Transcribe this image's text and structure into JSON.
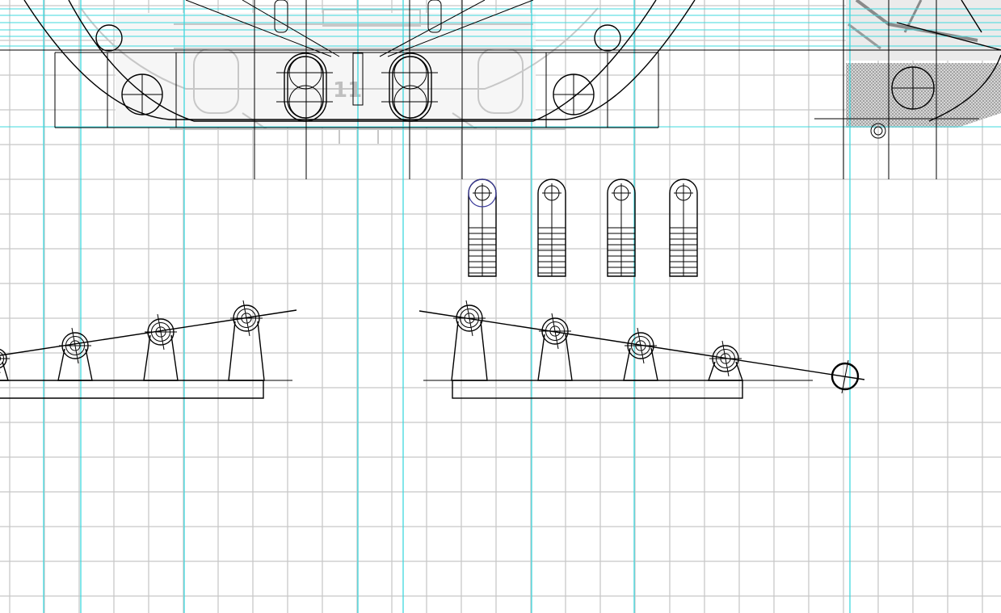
{
  "colors": {
    "background": "#ffffff",
    "grid": "#c8c8c8",
    "guide": "#3fd8de",
    "ink": "#000000",
    "reference_image": "#c7c7c7",
    "hatch": "#9a9a9a",
    "selection": "#3a3a9a"
  },
  "reference_label": "11"
}
